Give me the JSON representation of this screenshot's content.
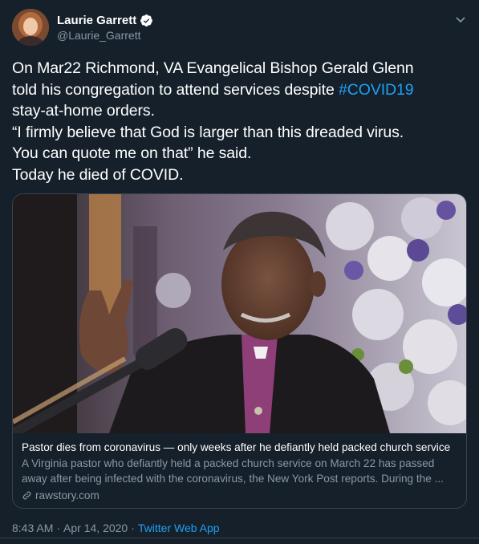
{
  "author": {
    "display_name": "Laurie Garrett",
    "handle": "@Laurie_Garrett",
    "verified": true
  },
  "tweet": {
    "lines": [
      "On Mar22 Richmond, VA Evangelical Bishop Gerald Glenn",
      "told his congregation to attend services despite ",
      " stay-at-home orders.",
      "“I firmly believe that God is larger than this dreaded virus.",
      "You can quote me on that” he said.",
      "Today he died of COVID."
    ],
    "hashtag": "#COVID19"
  },
  "card": {
    "title": "Pastor dies from coronavirus — only weeks after he defiantly held packed church service",
    "description_line1": "A Virginia pastor who defiantly held a packed church service on March 22 has passed",
    "description_line2": "away after being infected with the coronavirus, the New York Post reports. During the ...",
    "domain": "rawstory.com"
  },
  "meta": {
    "time": "8:43 AM",
    "separator": "·",
    "date": "Apr 14, 2020",
    "source": "Twitter Web App"
  },
  "colors": {
    "background": "#15202b",
    "text": "#ffffff",
    "secondary": "#8899a6",
    "accent": "#1da1f2",
    "border": "#38444d"
  }
}
